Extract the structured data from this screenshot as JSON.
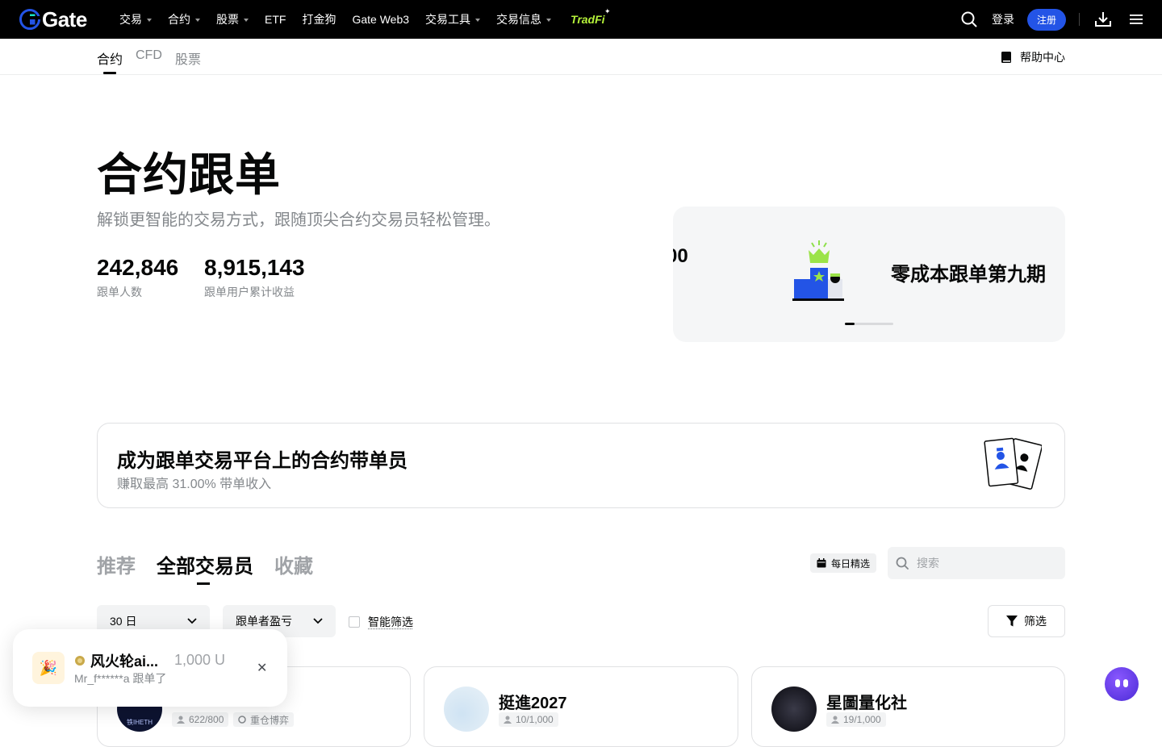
{
  "topnav": {
    "logo_text": "Gate",
    "items": [
      {
        "label": "交易",
        "has_caret": true
      },
      {
        "label": "合约",
        "has_caret": true
      },
      {
        "label": "股票",
        "has_caret": true
      },
      {
        "label": "ETF",
        "has_caret": false
      },
      {
        "label": "打金狗",
        "has_caret": false
      },
      {
        "label": "Gate Web3",
        "has_caret": false
      },
      {
        "label": "交易工具",
        "has_caret": true
      },
      {
        "label": "交易信息",
        "has_caret": true
      }
    ],
    "tradfi_label": "TradFi",
    "login_label": "登录",
    "register_label": "注册"
  },
  "subnav": {
    "tabs": [
      "合约",
      "CFD",
      "股票"
    ],
    "active_tab": "合约",
    "help_label": "帮助中心"
  },
  "hero": {
    "title": "合约跟单",
    "subtitle": "解锁更智能的交易方式，跟随顶尖合约交易员轻松管理。",
    "stats": [
      {
        "value": "242,846",
        "label": "跟单人数"
      },
      {
        "value": "8,915,143",
        "label": "跟单用户累计收益"
      }
    ]
  },
  "banner": {
    "partial_text": "00",
    "title": "零成本跟单第九期",
    "slide_progress": 0.2
  },
  "promo": {
    "title": "成为跟单交易平台上的合约带单员",
    "subtitle": "赚取最高 31.00% 带单收入"
  },
  "trader_tabs": {
    "tabs": [
      "推荐",
      "全部交易员",
      "收藏"
    ],
    "active": "全部交易员",
    "daily_label": "每日精选",
    "search_placeholder": "搜索"
  },
  "filters": {
    "period": "30 日",
    "sort": "跟单者盈亏",
    "smart_label": "智能筛选",
    "smart_checked": false,
    "filter_label": "筛选"
  },
  "cards": [
    {
      "name": "",
      "followers": "622/800",
      "tag": "重仓博弈",
      "avatar_text": "铁IHETH"
    },
    {
      "name": "挺進2027",
      "followers": "10/1,000",
      "tag": "",
      "avatar_text": ""
    },
    {
      "name": "星圖量化社",
      "followers": "19/1,000",
      "tag": "",
      "avatar_text": ""
    }
  ],
  "toast": {
    "title": "风火轮ai...",
    "amount": "1,000 U",
    "subtitle": "Mr_f******a 跟单了"
  },
  "colors": {
    "accent": "#2354e6",
    "tradfi": "#b5f23a",
    "bot": "#6a3cf0"
  }
}
